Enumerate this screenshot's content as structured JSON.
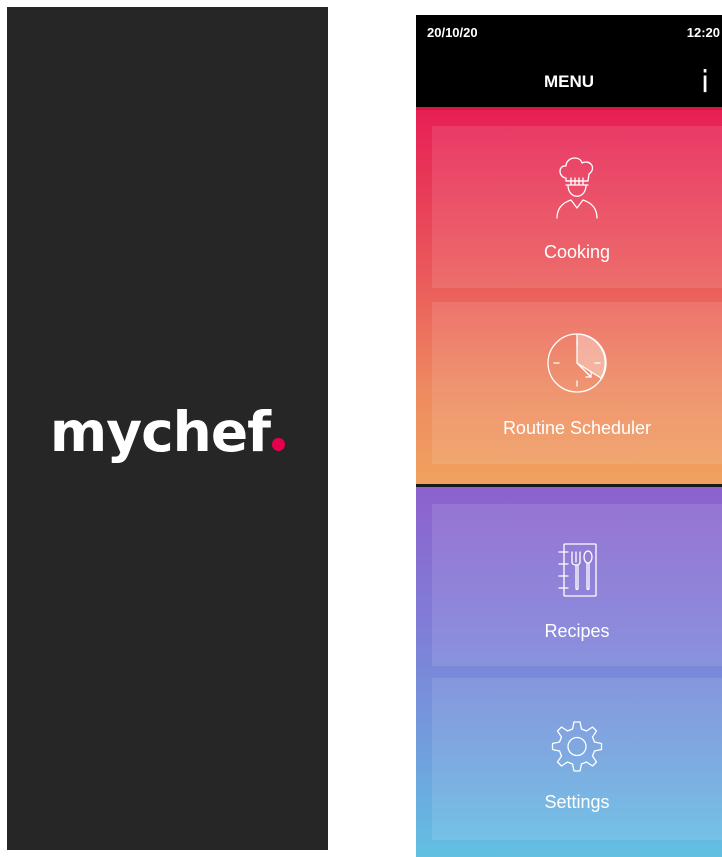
{
  "splash": {
    "logo_text": "mychef",
    "logo_dot_color": "#e5004f",
    "background": "#262626"
  },
  "device": {
    "status": {
      "date": "20/10/20",
      "time": "12:20"
    },
    "header": {
      "title": "MENU",
      "info_label": "i"
    },
    "menu": [
      {
        "label": "Cooking",
        "icon": "chef-icon"
      },
      {
        "label": "Routine Scheduler",
        "icon": "clock-icon"
      },
      {
        "label": "Recipes",
        "icon": "recipe-book-icon"
      },
      {
        "label": "Settings",
        "icon": "gear-icon"
      }
    ],
    "colors": {
      "accent_red": "#d8173a",
      "warm_top": "#e71f55",
      "warm_bottom": "#f0a25f",
      "cool_top": "#8d62cd",
      "cool_bottom": "#62c0e3"
    }
  }
}
